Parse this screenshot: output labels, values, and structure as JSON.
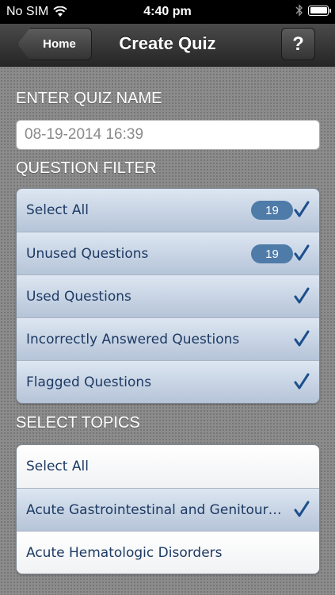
{
  "status_bar": {
    "carrier": "No SIM",
    "time": "4:40 pm"
  },
  "nav": {
    "back_label": "Home",
    "title": "Create Quiz",
    "help_label": "?"
  },
  "quiz_name": {
    "header": "ENTER QUIZ NAME",
    "value": "08-19-2014 16:39"
  },
  "question_filter": {
    "header": "QUESTION FILTER",
    "rows": [
      {
        "label": "Select All",
        "count": "19",
        "checked": true
      },
      {
        "label": "Unused Questions",
        "count": "19",
        "checked": true
      },
      {
        "label": "Used Questions",
        "checked": true
      },
      {
        "label": "Incorrectly Answered Questions",
        "checked": true
      },
      {
        "label": "Flagged Questions",
        "checked": true
      }
    ]
  },
  "topics": {
    "header": "SELECT TOPICS",
    "rows": [
      {
        "label": "Select All",
        "checked": false
      },
      {
        "label": "Acute Gastrointestinal and Genitour…",
        "checked": true
      },
      {
        "label": "Acute Hematologic Disorders",
        "checked": false
      }
    ]
  },
  "colors": {
    "accent": "#1d3a63",
    "badge": "#4f7ba9",
    "selected_row": "#c7d3e3"
  }
}
